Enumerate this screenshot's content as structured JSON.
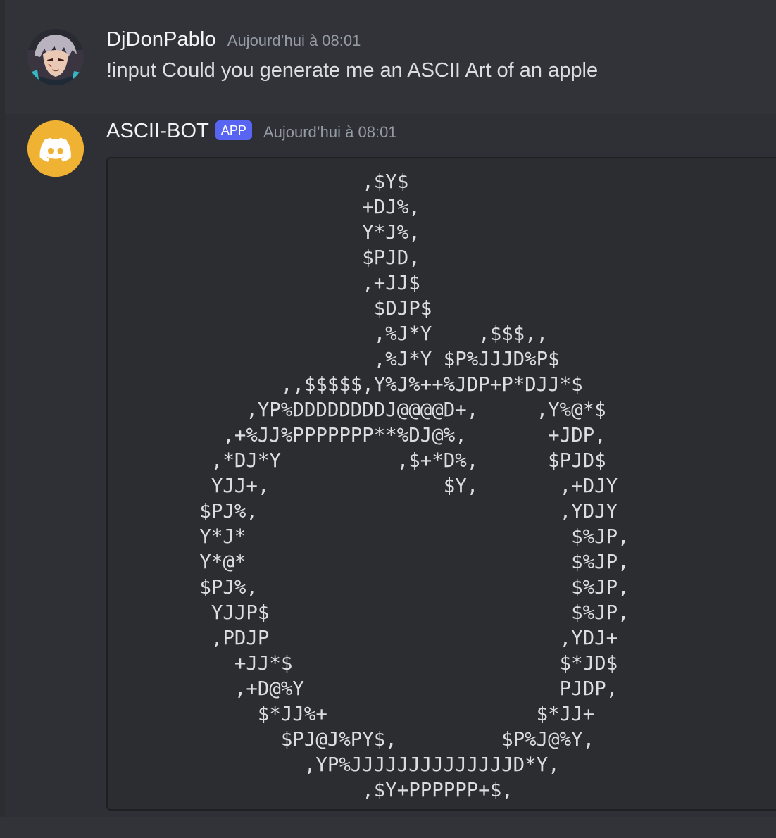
{
  "messages": [
    {
      "author": "DjDonPablo",
      "timestamp": "Aujourd’hui à 08:01",
      "avatar_icon": "user-avatar-anime",
      "content": "!input Could you generate me an ASCII Art of an apple"
    },
    {
      "author": "ASCII-BOT",
      "badge": "APP",
      "timestamp": "Aujourd’hui à 08:01",
      "avatar_icon": "discord-logo-icon",
      "avatar_color": "#f0b232",
      "code": "                     ,$Y$\n                     +DJ%,\n                     Y*J%,\n                     $PJD,\n                     ,+JJ$\n                      $DJP$\n                      ,%J*Y    ,$$$,,\n                      ,%J*Y $P%JJJD%P$\n              ,,$$$$$,Y%J%++%JDP+P*DJJ*$\n           ,YP%DDDDDDDDJ@@@@D+,     ,Y%@*$\n         ,+%JJ%PPPPPPP**%DJ@%,       +JDP,\n        ,*DJ*Y          ,$+*D%,      $PJD$\n        YJJ+,               $Y,       ,+DJY\n       $PJ%,                          ,YDJY\n       Y*J*                            $%JP,\n       Y*@*                            $%JP,\n       $PJ%,                           $%JP,\n        YJJP$                          $%JP,\n        ,PDJP                         ,YDJ+\n          +JJ*$                       $*JD$\n          ,+D@%Y                      PJDP,\n            $*JJ%+                  $*JJ+\n              $PJ@J%PY$,         $P%J@%Y,\n                ,YP%JJJJJJJJJJJJJJD*Y,\n                     ,$Y+PPPPPP+$,"
    }
  ],
  "colors": {
    "background": "#313338",
    "bot_message_bg": "#2e3035",
    "codeblock_bg": "#2b2d31",
    "badge": "#5865f2",
    "timestamp": "#949ba4"
  }
}
